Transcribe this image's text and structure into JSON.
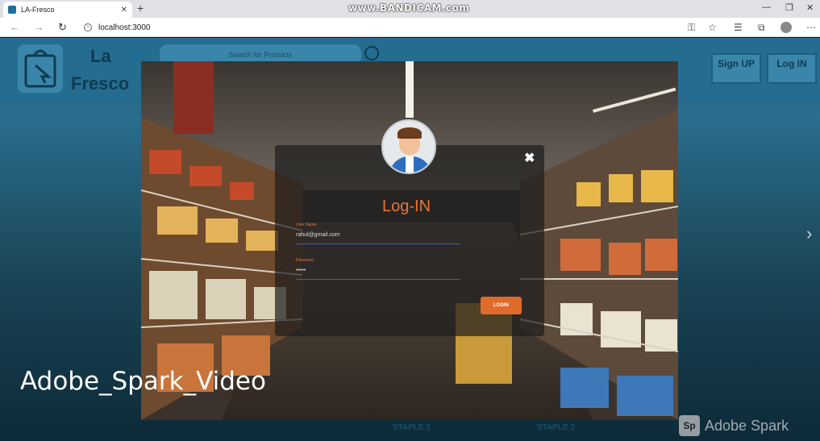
{
  "browser": {
    "tab_title": "LA-Fresco",
    "new_tab": "+",
    "tab_close": "✕",
    "url": "localhost:3000",
    "watermark": "www.BANDICAM.com",
    "window_controls": [
      "—",
      "❐",
      "✕"
    ],
    "nav": {
      "back": "←",
      "forward": "→",
      "refresh": "↻"
    },
    "tools": [
      "⚿",
      "☆",
      "☰",
      "⧉",
      "⋯"
    ]
  },
  "site": {
    "logo_line1": "La",
    "logo_line2": "Fresco",
    "search_placeholder": "Search for Products",
    "signup_label": "Sign UP",
    "login_label": "Log IN",
    "staples": [
      "STAPLE 1",
      "STAPLE 2"
    ],
    "carousel_next": "›"
  },
  "modal": {
    "close": "✖",
    "title": "Log-IN",
    "username_label": "User Name",
    "username_value": "rahul@gmail.com",
    "password_label": "Password",
    "password_value": "•••••",
    "login_button": "LOGIN"
  },
  "overlay": {
    "caption": "Adobe_Spark_Video",
    "brand_badge": "Sp",
    "brand_name": "Adobe Spark"
  },
  "colors": {
    "accent": "#e06a2a",
    "header": "#256d90",
    "title": "#e8743a"
  }
}
